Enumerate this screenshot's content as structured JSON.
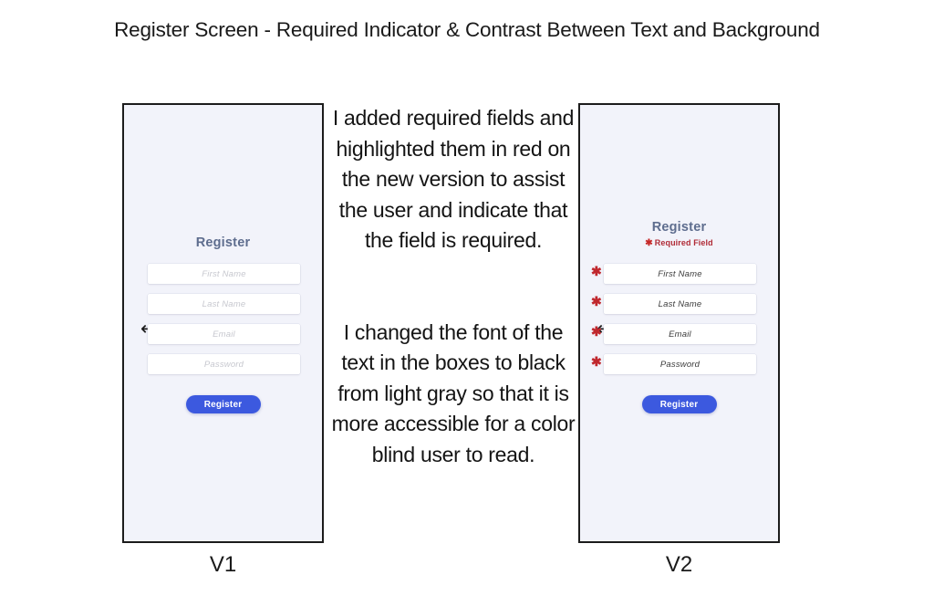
{
  "page": {
    "title": "Register Screen - Required Indicator & Contrast Between Text and Background"
  },
  "colors": {
    "phone_background": "#f2f3fa",
    "phone_border": "#1c1c1c",
    "screen_title": "#5e6d8e",
    "required_red": "#c0272d",
    "required_note_text": "#b02b36",
    "button_blue": "#3c59df",
    "placeholder_v1": "#c7c8cf",
    "placeholder_v2": "#3c3c3c"
  },
  "versions": [
    {
      "caption": "V1",
      "back_icon": "←",
      "screen_title": "Register",
      "required_note": null,
      "required_note_asterisk": null,
      "fields": [
        {
          "placeholder": "First Name",
          "required_marker": null
        },
        {
          "placeholder": "Last Name",
          "required_marker": null
        },
        {
          "placeholder": "Email",
          "required_marker": null
        },
        {
          "placeholder": "Password",
          "required_marker": null
        }
      ],
      "submit_label": "Register"
    },
    {
      "caption": "V2",
      "back_icon": "←",
      "screen_title": "Register",
      "required_note": "Required Field",
      "required_note_asterisk": "✱",
      "fields": [
        {
          "placeholder": "First Name",
          "required_marker": "✱"
        },
        {
          "placeholder": "Last Name",
          "required_marker": "✱"
        },
        {
          "placeholder": "Email",
          "required_marker": "✱"
        },
        {
          "placeholder": "Password",
          "required_marker": "✱"
        }
      ],
      "submit_label": "Register"
    }
  ],
  "annotations": {
    "paragraph_1": "I added required fields and highlighted them in red on the new version to assist the user and indicate that the field is required.",
    "paragraph_2": "I changed the font of the text in the boxes to black from light gray so that it is more accessible for a color blind user to read."
  }
}
